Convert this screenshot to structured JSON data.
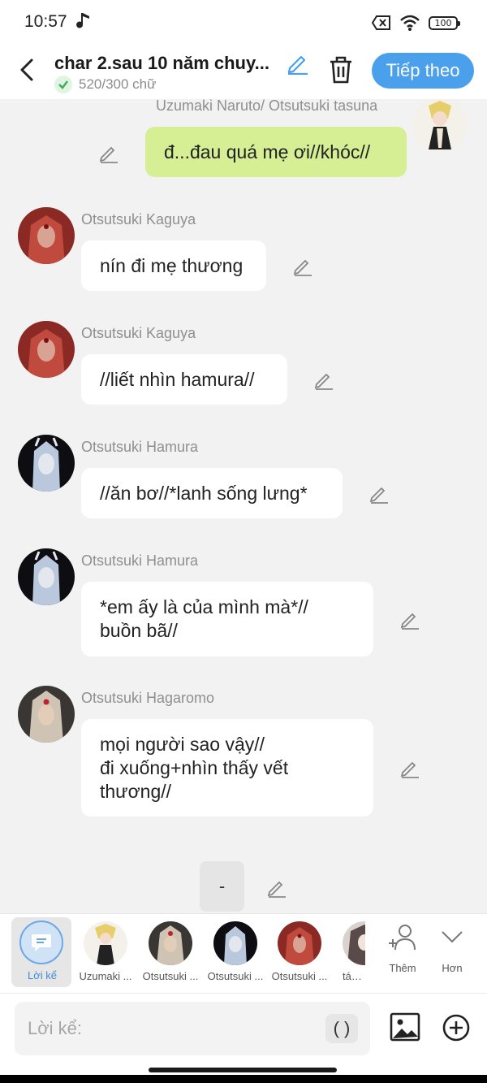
{
  "status": {
    "time": "10:57",
    "battery": "100"
  },
  "header": {
    "title": "char 2.sau 10 năm chuy...",
    "word_count": "520/300 chữ",
    "next_label": "Tiếp theo"
  },
  "messages": [
    {
      "sender": "Uzumaki Naruto/ Otsutsuki tasuna",
      "text": "đ...đau quá mẹ ơi//khóc//",
      "side": "right"
    },
    {
      "sender": "Otsutsuki Kaguya",
      "text": "nín đi mẹ thương",
      "side": "left"
    },
    {
      "sender": "Otsutsuki Kaguya",
      "text": "//liết nhìn hamura//",
      "side": "left"
    },
    {
      "sender": "Otsutsuki Hamura",
      "text": "//ăn bơ//*lanh sống lưng*",
      "side": "left"
    },
    {
      "sender": "Otsutsuki Hamura",
      "line1": "*em ấy là của mình mà*//",
      "line2": "buồn bã//",
      "side": "left"
    },
    {
      "sender": "Otsutsuki Hagaromo",
      "line1": "mọi người sao vậy//",
      "line2": "đi xuống+nhìn thấy vết",
      "line3": "thương//",
      "side": "left"
    }
  ],
  "narration_box": "-",
  "character_bar": {
    "narrator_label": "Lời kể",
    "characters": [
      "Uzumaki ...",
      "Otsutsuki ...",
      "Otsutsuki ...",
      "Otsutsuki ...",
      "tác g"
    ],
    "add_label": "Thêm",
    "more_label": "Hơn"
  },
  "input": {
    "placeholder": "Lời kể:",
    "paren_label": "( )"
  },
  "colors": {
    "accent": "#4ba0ec",
    "my_bubble": "#d6ee94",
    "background": "#f2f2f2"
  },
  "icons": [
    "music-note-icon",
    "close-box-icon",
    "wifi-icon",
    "battery-icon",
    "back-arrow-icon",
    "check-icon",
    "edit-icon",
    "trash-icon",
    "chat-bubble-icon",
    "add-person-icon",
    "chevron-down-icon",
    "image-icon",
    "plus-circle-icon"
  ]
}
